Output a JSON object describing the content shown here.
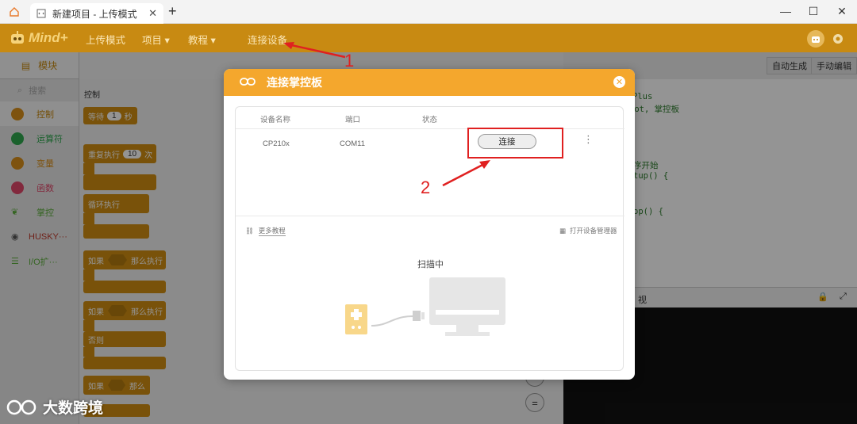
{
  "window": {
    "tab_title": "新建项目 - 上传模式",
    "new_tab": "+",
    "minimize": "—",
    "maximize": "☐",
    "close": "✕"
  },
  "appbar": {
    "logo": "Mind+",
    "menu": [
      "上传模式",
      "项目 ▾",
      "教程 ▾",
      "连接设备"
    ]
  },
  "sidebar": {
    "tab": "模块",
    "search_placeholder": "搜索",
    "categories": [
      {
        "label": "控制",
        "color": "#d9901a"
      },
      {
        "label": "运算符",
        "color": "#2fa84f"
      },
      {
        "label": "变量",
        "color": "#d9901a"
      },
      {
        "label": "函数",
        "color": "#e0476a"
      },
      {
        "label": "掌控",
        "color": "#5cae3c"
      },
      {
        "label": "HUSKY···",
        "color": "#555555"
      },
      {
        "label": "I/O扩···",
        "color": "#5cae3c"
      }
    ]
  },
  "palette": {
    "title": "控制",
    "blocks": [
      "等待",
      "1",
      "秒",
      "重复执行",
      "10",
      "次",
      "循环执行",
      "如果",
      "那么执行",
      "如果",
      "那么执行",
      "否则",
      "如果",
      "那么"
    ]
  },
  "code": {
    "auto_generate": "自动生成",
    "manual_edit": "手动编辑",
    "lines": [
      "Plus",
      "bot, 掌控板",
      "序开始",
      "tup() {",
      "op() {"
    ],
    "serial_label": "视"
  },
  "dialog": {
    "title": "连接掌控板",
    "close": "✕",
    "columns": [
      "设备名称",
      "端口",
      "状态"
    ],
    "device": {
      "name": "CP210x",
      "port": "COM11",
      "status": ""
    },
    "connect_button": "连接",
    "more": "⋮",
    "more_tutorials": "更多教程",
    "open_device_manager": "打开设备管理器",
    "scanning": "扫描中"
  },
  "annotations": {
    "step1": "1",
    "step2": "2",
    "accent": "#e02020"
  },
  "watermark": "大数跨境"
}
